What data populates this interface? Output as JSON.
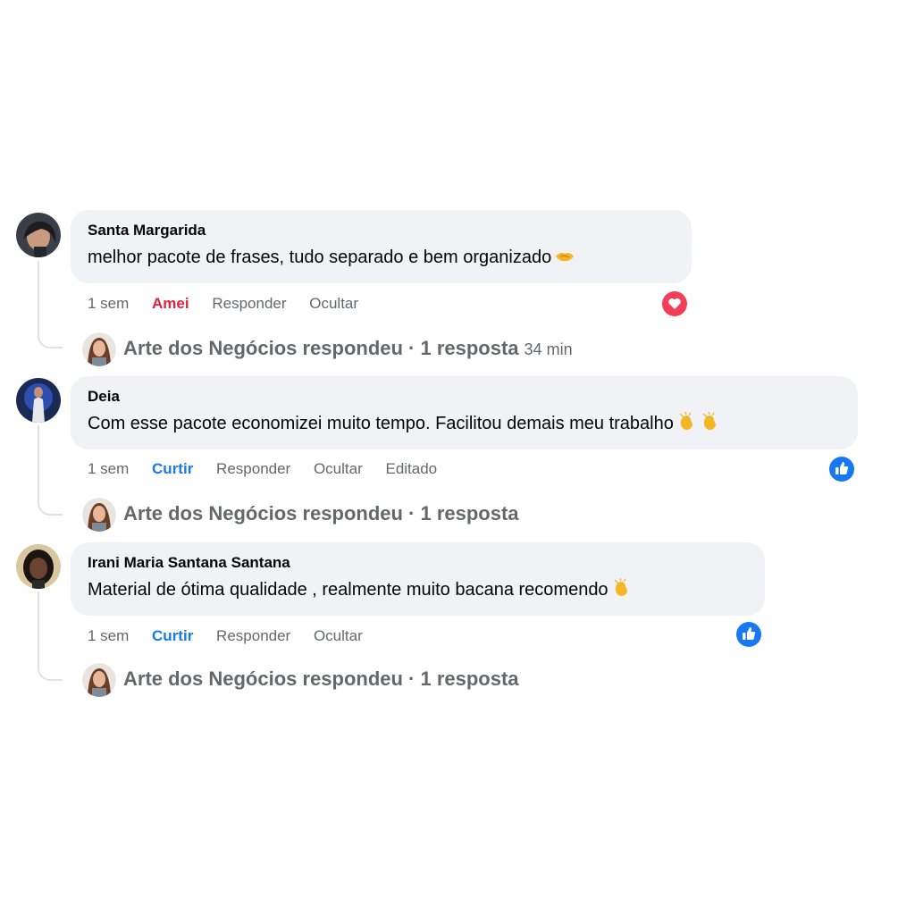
{
  "comments": [
    {
      "author": "Santa Margarida",
      "text": "melhor pacote de frases, tudo separado e bem organizado",
      "emoji": "handshake-emoji",
      "time": "1 sem",
      "like_label": "Amei",
      "reply_label": "Responder",
      "hide_label": "Ocultar",
      "edited_label": "",
      "reaction": "love-reaction-icon",
      "reply_summary": "Arte dos Negócios respondeu · 1 resposta",
      "reply_time": "34 min"
    },
    {
      "author": "Deia",
      "text": "Com esse pacote economizei muito tempo. Facilitou demais meu trabalho",
      "emoji": "clapping-hands-emoji",
      "time": "1 sem",
      "like_label": "Curtir",
      "reply_label": "Responder",
      "hide_label": "Ocultar",
      "edited_label": "Editado",
      "reaction": "like-reaction-icon",
      "reply_summary": "Arte dos Negócios respondeu · 1 resposta",
      "reply_time": ""
    },
    {
      "author": "Irani Maria Santana Santana",
      "text": "Material de ótima qualidade , realmente muito bacana recomendo",
      "emoji": "clapping-hands-emoji",
      "time": "1 sem",
      "like_label": "Curtir",
      "reply_label": "Responder",
      "hide_label": "Ocultar",
      "edited_label": "",
      "reaction": "like-reaction-icon",
      "reply_summary": "Arte dos Negócios respondeu · 1 resposta",
      "reply_time": ""
    }
  ],
  "colors": {
    "bubble_bg": "#f0f2f5",
    "secondary_text": "#65676b",
    "love": "#e41e3f",
    "like": "#1877f2"
  }
}
